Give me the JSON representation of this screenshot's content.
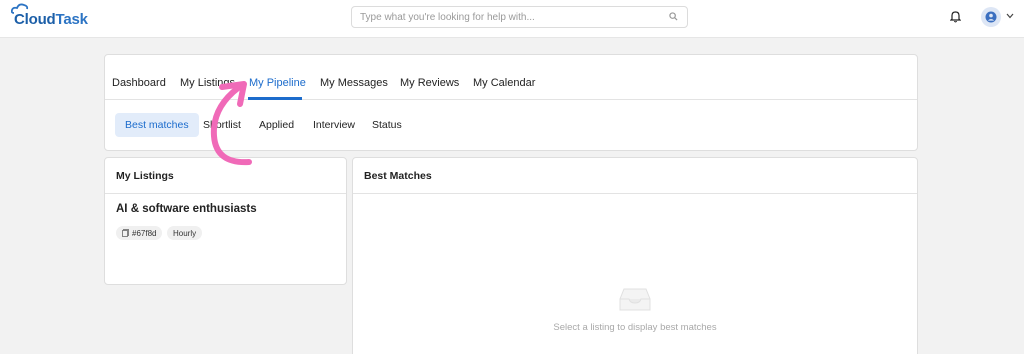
{
  "brand": {
    "logo_text_1": "Cloud",
    "logo_text_2": "Task"
  },
  "header": {
    "search_placeholder": "Type what you're looking for help with...",
    "search_icon": "search-icon",
    "notification_icon": "bell-icon",
    "avatar_icon": "user-avatar-icon",
    "menu_icon": "chevron-down-icon"
  },
  "tabs": [
    {
      "label": "Dashboard"
    },
    {
      "label": "My Listings"
    },
    {
      "label": "My Pipeline",
      "active": true
    },
    {
      "label": "My Messages"
    },
    {
      "label": "My Reviews"
    },
    {
      "label": "My Calendar"
    }
  ],
  "subtabs": [
    {
      "label": "Best matches",
      "active": true
    },
    {
      "label": "Shortlist"
    },
    {
      "label": "Applied"
    },
    {
      "label": "Interview"
    },
    {
      "label": "Status"
    }
  ],
  "listings_panel": {
    "title": "My Listings",
    "listing": {
      "name": "AI & software enthusiasts",
      "id": "#67f8d",
      "type": "Hourly"
    }
  },
  "matches_panel": {
    "title": "Best Matches",
    "empty_text": "Select a listing to display best matches",
    "empty_icon": "inbox-icon"
  },
  "colors": {
    "accent": "#1c6ccc",
    "arrow": "#f06ab8"
  }
}
